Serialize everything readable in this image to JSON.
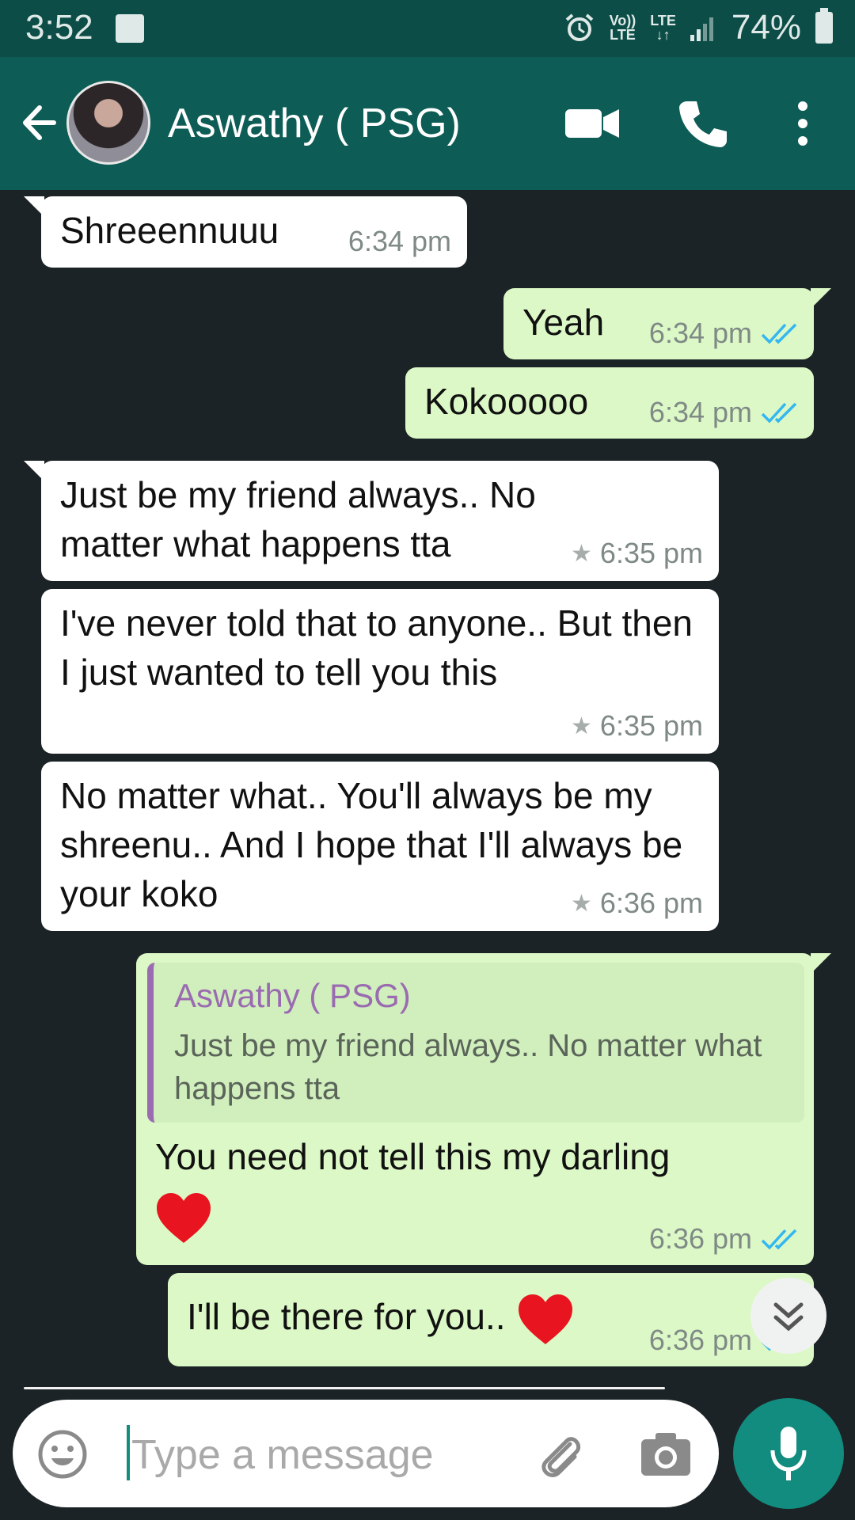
{
  "status_bar": {
    "time": "3:52",
    "net_top": "Vo))",
    "net_bottom": "LTE",
    "lte_top": "LTE",
    "lte_bottom": "↓↑",
    "battery": "74%"
  },
  "header": {
    "contact_name": "Aswathy ( PSG)"
  },
  "messages": [
    {
      "dir": "in",
      "text": "Shreeennuuu",
      "time": "6:34 pm"
    },
    {
      "dir": "out",
      "text": "Yeah",
      "time": "6:34 pm"
    },
    {
      "dir": "out",
      "text": "Kokooooo",
      "time": "6:34 pm"
    },
    {
      "dir": "in",
      "text": "Just be my friend always.. No matter what happens tta",
      "time": "6:35 pm",
      "starred": true
    },
    {
      "dir": "in",
      "text": "I've never told that to anyone.. But then I just wanted to tell you this",
      "time": "6:35 pm",
      "starred": true
    },
    {
      "dir": "in",
      "text": "No matter what.. You'll always be my shreenu.. And I hope that I'll always be  your koko",
      "time": "6:36 pm",
      "starred": true
    },
    {
      "dir": "out",
      "reply_to": {
        "name": "Aswathy ( PSG)",
        "text": "Just be my friend always.. No matter what happens tta"
      },
      "text": "You need not tell this my darling",
      "time": "6:36 pm"
    },
    {
      "dir": "out",
      "text": "I'll be there for you..",
      "time": "6:36 pm"
    }
  ],
  "composer": {
    "placeholder": "Type a message"
  },
  "icons": {
    "header": [
      "back-arrow-icon",
      "video-call-icon",
      "phone-icon",
      "more-options-icon"
    ],
    "composer": [
      "emoji-icon",
      "attach-icon",
      "camera-icon",
      "mic-icon"
    ]
  },
  "colors": {
    "app_bar": "#0d5c55",
    "status_bar": "#0d4d47",
    "chat_background": "#1b2326",
    "incoming_bubble": "#ffffff",
    "outgoing_bubble": "#dcf8c6",
    "read_tick": "#34b7f1",
    "accent": "#128c7e"
  }
}
